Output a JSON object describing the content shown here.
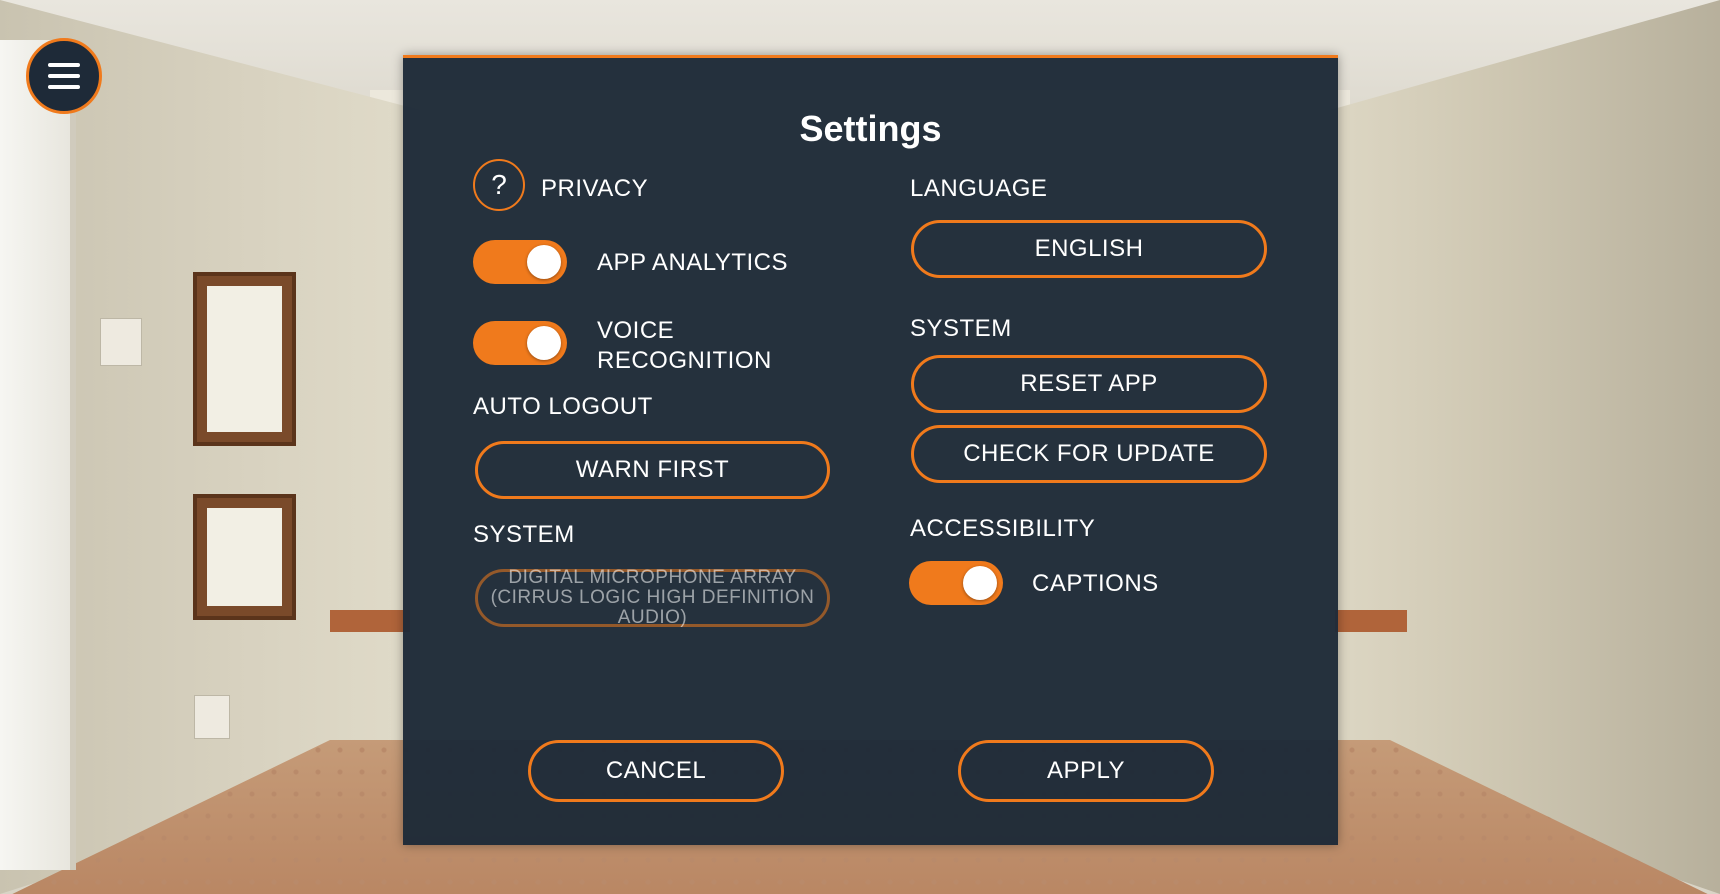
{
  "menu": {
    "icon": "hamburger-menu-icon"
  },
  "dialog": {
    "title": "Settings",
    "privacy": {
      "heading": "PRIVACY",
      "help_icon": "question-mark-icon",
      "help_glyph": "?",
      "app_analytics": {
        "label": "APP ANALYTICS",
        "on": true
      },
      "voice_recognition": {
        "label_line1": "VOICE",
        "label_line2": "RECOGNITION",
        "on": true
      }
    },
    "auto_logout": {
      "heading": "AUTO LOGOUT",
      "value": "WARN FIRST"
    },
    "system_left": {
      "heading": "SYSTEM",
      "microphone": "DIGITAL MICROPHONE ARRAY (CIRRUS LOGIC HIGH DEFINITION AUDIO)"
    },
    "language": {
      "heading": "LANGUAGE",
      "value": "ENGLISH"
    },
    "system_right": {
      "heading": "SYSTEM",
      "reset_label": "RESET APP",
      "update_label": "CHECK FOR UPDATE"
    },
    "accessibility": {
      "heading": "ACCESSIBILITY",
      "captions": {
        "label": "CAPTIONS",
        "on": true
      }
    },
    "cancel_label": "CANCEL",
    "apply_label": "APPLY"
  },
  "colors": {
    "accent": "#f07a1c",
    "panel": "#1e2a38",
    "text": "#ffffff"
  }
}
